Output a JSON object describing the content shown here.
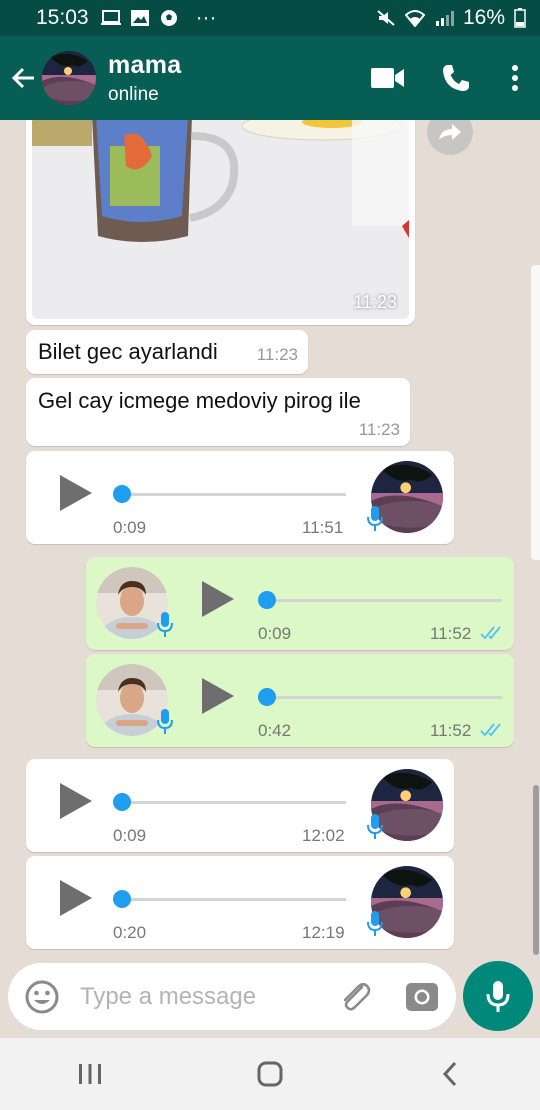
{
  "status_bar": {
    "time": "15:03",
    "notification_icons": [
      "screen-cast-icon",
      "gallery-icon",
      "soccer-icon"
    ],
    "more": "···",
    "battery_percent": "16%"
  },
  "header": {
    "contact_name": "mama",
    "contact_status": "online",
    "actions": [
      "video-call-icon",
      "voice-call-icon",
      "overflow-menu-icon"
    ]
  },
  "messages": {
    "image": {
      "time": "11:23"
    },
    "text1": {
      "text": "Bilet gec ayarlandi",
      "time": "11:23"
    },
    "text2": {
      "text": "Gel  cay  icmege medoviy pirog ile",
      "time": "11:23"
    },
    "voice1": {
      "duration": "0:09",
      "time": "11:51",
      "direction": "incoming",
      "progress": 0
    },
    "voice2": {
      "duration": "0:09",
      "time": "11:52",
      "direction": "outgoing",
      "progress": 0
    },
    "voice3": {
      "duration": "0:42",
      "time": "11:52",
      "direction": "outgoing",
      "progress": 0
    },
    "voice4": {
      "duration": "0:09",
      "time": "12:02",
      "direction": "incoming",
      "progress": 0
    },
    "voice5": {
      "duration": "0:20",
      "time": "12:19",
      "direction": "incoming",
      "progress": 0
    }
  },
  "input": {
    "placeholder": "Type a message"
  },
  "colors": {
    "header": "#075e54",
    "status_bar": "#054d44",
    "chat_bg": "#e5ddd5",
    "outgoing_bubble": "#dcf8c6",
    "accent": "#00897b",
    "voice_knob": "#1f9ef0",
    "read_ticks": "#4fc3f7"
  }
}
